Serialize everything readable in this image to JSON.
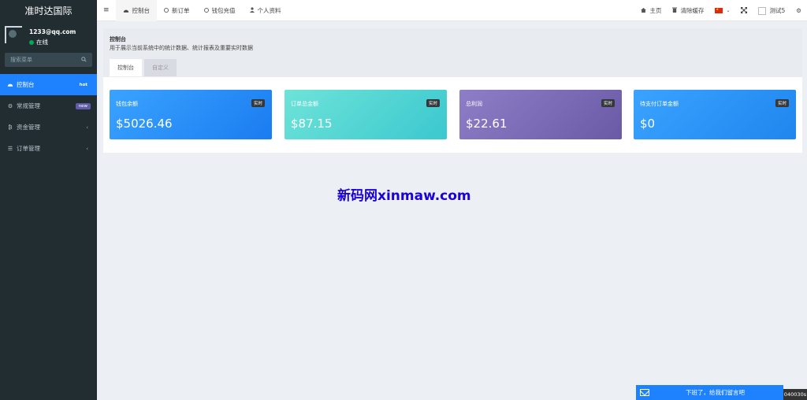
{
  "sidebar": {
    "brand": "准时达国际",
    "user": {
      "name": "1233@qq.com",
      "status": "在线"
    },
    "search_placeholder": "搜索菜单",
    "items": [
      {
        "label": "控制台",
        "badge": "hot"
      },
      {
        "label": "常规管理",
        "badge": "new"
      },
      {
        "label": "资金管理"
      },
      {
        "label": "订单管理"
      }
    ]
  },
  "navbar": {
    "tabs": [
      {
        "label": "控制台"
      },
      {
        "label": "新订单"
      },
      {
        "label": "钱包充值"
      },
      {
        "label": "个人资料"
      }
    ],
    "right": {
      "home": "主页",
      "clear_cache": "清除缓存",
      "username": "测试5"
    }
  },
  "content_header": {
    "title": "控制台",
    "description": "用于展示当前系统中的统计数据、统计报表及重要实时数据",
    "tabs": [
      {
        "label": "控制台"
      },
      {
        "label": "自定义"
      }
    ]
  },
  "cards": [
    {
      "label": "钱包余额",
      "tag": "实时",
      "value": "$5026.46"
    },
    {
      "label": "订单总金额",
      "tag": "实时",
      "value": "$87.15"
    },
    {
      "label": "总利润",
      "tag": "实时",
      "value": "$22.61"
    },
    {
      "label": "待支付订单金额",
      "tag": "实时",
      "value": "$0"
    }
  ],
  "watermark": "新码网xinmaw.com",
  "message_bar": {
    "text": "下班了，给我们留言吧"
  },
  "corner_tag": "040030s",
  "colors": {
    "accent": "#1e82ff",
    "sidebar_bg": "#222d32",
    "online": "#00a65a"
  }
}
